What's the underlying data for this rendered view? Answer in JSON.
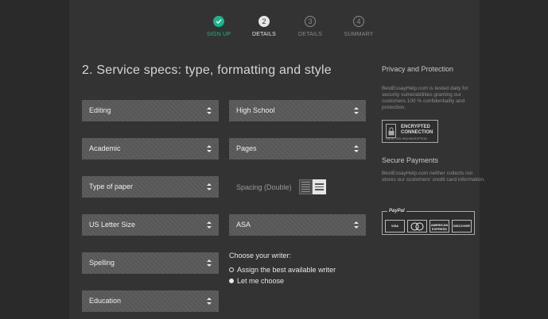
{
  "steps": [
    {
      "label": "SIGN UP",
      "number": "",
      "state": "done"
    },
    {
      "label": "DETAILS",
      "number": "2",
      "state": "active"
    },
    {
      "label": "DETAILS",
      "number": "3",
      "state": "pending"
    },
    {
      "label": "SUMMARY",
      "number": "4",
      "state": "pending"
    }
  ],
  "form": {
    "title": "2. Service specs: type, formatting and style",
    "left_selects": [
      "Editing",
      "Academic",
      "Type of paper",
      "US Letter Size",
      "Spelling",
      "Education"
    ],
    "right_selects": [
      "High School",
      "Pages"
    ],
    "spacing_label": "Spacing (Double)",
    "citation_select": "ASA",
    "writer_title": "Choose your writer:",
    "writer_options": [
      "Assign the best available writer",
      "Let me choose"
    ],
    "writer_selected": 1
  },
  "sidebar": {
    "privacy_title": "Privacy and Protection",
    "privacy_text": "BestEssayHelp.com is tested daily for security vulnerabilities granting our customers 100 % confidentiality and protection.",
    "badge_line1": "ENCRYPTED",
    "badge_line2": "CONNECTION",
    "badge_line3": "256 BIT SSL RSA ENCRYPTION",
    "payments_title": "Secure Payments",
    "payments_text": "BestEssayHelp.com neither collects nor stores our customers' credit card information.",
    "paypal": "PayPal",
    "cards": [
      "VISA",
      "MasterCard",
      "AMERICAN EXPRESS",
      "DISCOVER"
    ]
  },
  "colors": {
    "accent": "#19b58d",
    "field": "#595959",
    "page": "#333333",
    "background": "#2a2a2a"
  }
}
